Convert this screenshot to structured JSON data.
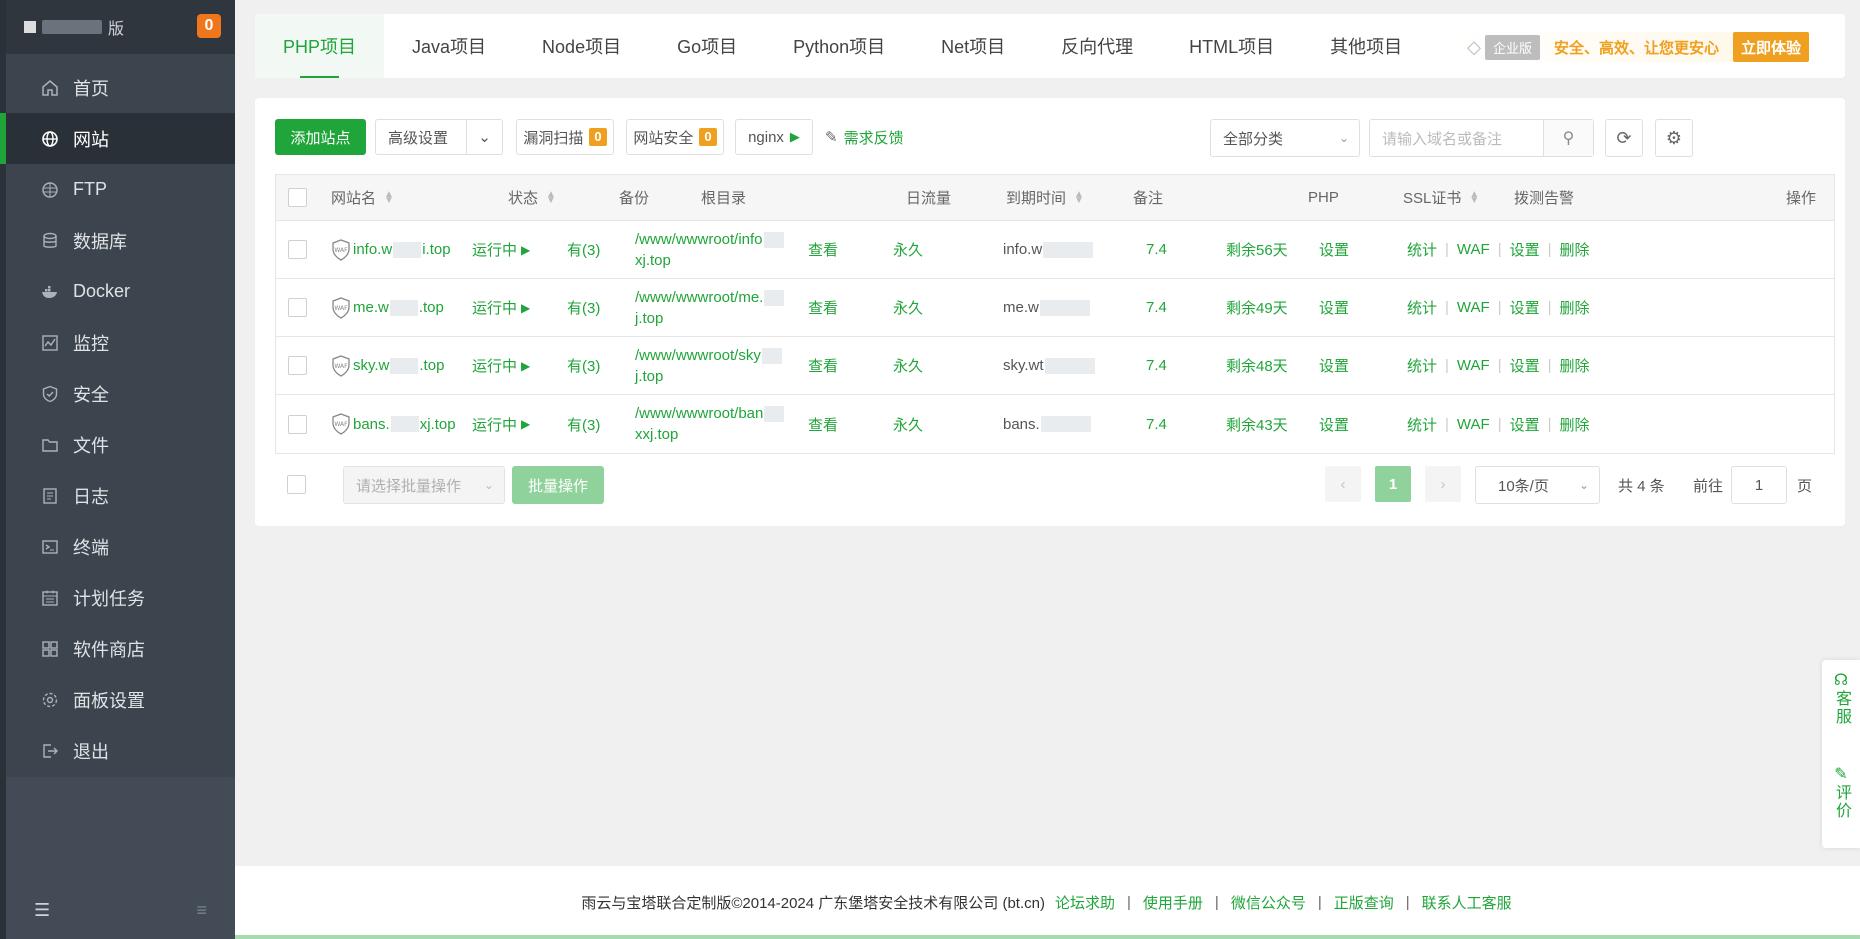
{
  "sidebar": {
    "title": "版",
    "badge": "0",
    "items": [
      {
        "label": "首页",
        "icon": "home-icon"
      },
      {
        "label": "网站",
        "icon": "globe-icon",
        "active": true
      },
      {
        "label": "FTP",
        "icon": "ftp-globe-icon"
      },
      {
        "label": "数据库",
        "icon": "database-icon"
      },
      {
        "label": "Docker",
        "icon": "docker-icon"
      },
      {
        "label": "监控",
        "icon": "monitor-icon"
      },
      {
        "label": "安全",
        "icon": "shield-icon"
      },
      {
        "label": "文件",
        "icon": "folder-icon"
      },
      {
        "label": "日志",
        "icon": "log-icon"
      },
      {
        "label": "终端",
        "icon": "terminal-icon"
      },
      {
        "label": "计划任务",
        "icon": "calendar-icon"
      },
      {
        "label": "软件商店",
        "icon": "apps-icon"
      },
      {
        "label": "面板设置",
        "icon": "gear-icon"
      },
      {
        "label": "退出",
        "icon": "logout-icon"
      }
    ]
  },
  "tabs": [
    "PHP项目",
    "Java项目",
    "Node项目",
    "Go项目",
    "Python项目",
    "Net项目",
    "反向代理",
    "HTML项目",
    "其他项目"
  ],
  "promo": {
    "edition": "企业版",
    "slogan": "安全、高效、让您更安心",
    "cta": "立即体验"
  },
  "toolbar": {
    "add_site": "添加站点",
    "advanced": "高级设置",
    "vuln_scan": "漏洞扫描",
    "vuln_count": "0",
    "site_security": "网站安全",
    "security_count": "0",
    "nginx": "nginx",
    "feedback": "需求反馈",
    "category": "全部分类",
    "search_placeholder": "请输入域名或备注"
  },
  "table": {
    "headers": [
      "网站名",
      "状态",
      "备份",
      "根目录",
      "日流量",
      "到期时间",
      "备注",
      "PHP",
      "SSL证书",
      "拨测告警",
      "操作"
    ],
    "rows": [
      {
        "name_a": "info.w",
        "name_b": "i.top",
        "status": "运行中",
        "backup": "有(3)",
        "path1": "/www/wwwroot/info",
        "path2": "xj.top",
        "traffic": "查看",
        "expire": "永久",
        "note": "info.w",
        "php": "7.4",
        "ssl": "剩余56天",
        "alert": "设置"
      },
      {
        "name_a": "me.w",
        "name_b": ".top",
        "status": "运行中",
        "backup": "有(3)",
        "path1": "/www/wwwroot/me.",
        "path2": "j.top",
        "traffic": "查看",
        "expire": "永久",
        "note": "me.w",
        "php": "7.4",
        "ssl": "剩余49天",
        "alert": "设置"
      },
      {
        "name_a": "sky.w",
        "name_b": ".top",
        "status": "运行中",
        "backup": "有(3)",
        "path1": "/www/wwwroot/sky",
        "path2": "j.top",
        "traffic": "查看",
        "expire": "永久",
        "note": "sky.wt",
        "php": "7.4",
        "ssl": "剩余48天",
        "alert": "设置"
      },
      {
        "name_a": "bans.",
        "name_b": "xj.top",
        "status": "运行中",
        "backup": "有(3)",
        "path1": "/www/wwwroot/ban",
        "path2": "xxj.top",
        "traffic": "查看",
        "expire": "永久",
        "note": "bans.",
        "php": "7.4",
        "ssl": "剩余43天",
        "alert": "设置"
      }
    ],
    "ops": [
      "统计",
      "WAF",
      "设置",
      "删除"
    ]
  },
  "batch": {
    "select_placeholder": "请选择批量操作",
    "button": "批量操作"
  },
  "pagination": {
    "current": "1",
    "page_size": "10条/页",
    "total": "共 4 条",
    "goto_label": "前往",
    "goto_value": "1",
    "page_unit": "页"
  },
  "footer": {
    "copyright": "雨云与宝塔联合定制版©2014-2024 广东堡塔安全技术有限公司 (bt.cn)",
    "links": [
      "论坛求助",
      "使用手册",
      "微信公众号",
      "正版查询",
      "联系人工客服"
    ]
  },
  "float": {
    "service": "客服",
    "review": "评价"
  },
  "colors": {
    "brand": "#20a53a",
    "sidebar": "#3c444d",
    "warning": "#f0a020"
  }
}
